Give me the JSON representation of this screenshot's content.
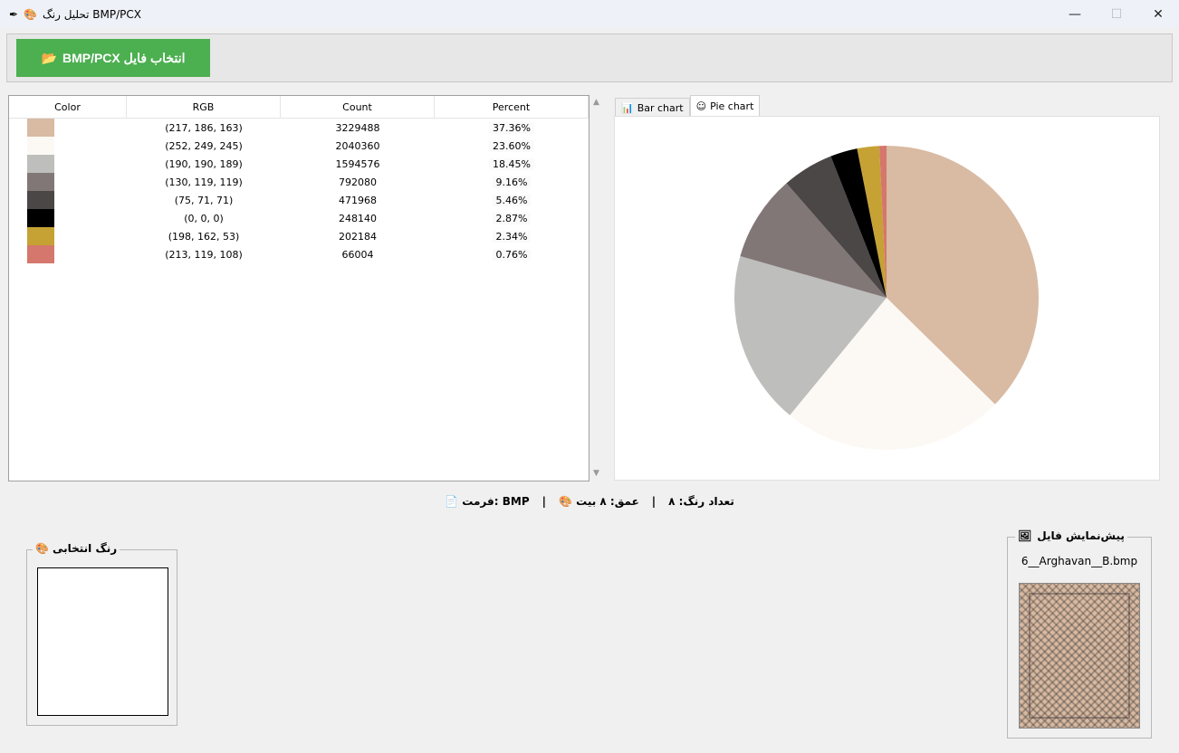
{
  "window": {
    "title": "تحلیل رنگ BMP/PCX",
    "controls": {
      "minimize": "—",
      "maximize": "☐",
      "close": "✕"
    }
  },
  "toolbar": {
    "pick_label": "انتخاب فایل BMP/PCX",
    "pick_icon": "📂",
    "button_color": "#4caf50"
  },
  "table": {
    "columns": [
      "Color",
      "RGB",
      "Count",
      "Percent"
    ],
    "rows": [
      {
        "color": "#d9baa3",
        "rgb": "(217, 186, 163)",
        "count": "3229488",
        "percent": "37.36%"
      },
      {
        "color": "#fcf9f5",
        "rgb": "(252, 249, 245)",
        "count": "2040360",
        "percent": "23.60%"
      },
      {
        "color": "#bebebd",
        "rgb": "(190, 190, 189)",
        "count": "1594576",
        "percent": "18.45%"
      },
      {
        "color": "#827777",
        "rgb": "(130, 119, 119)",
        "count": "792080",
        "percent": "9.16%"
      },
      {
        "color": "#4b4747",
        "rgb": "(75, 71, 71)",
        "count": "471968",
        "percent": "5.46%"
      },
      {
        "color": "#000000",
        "rgb": "(0, 0, 0)",
        "count": "248140",
        "percent": "2.87%"
      },
      {
        "color": "#c6a235",
        "rgb": "(198, 162, 53)",
        "count": "202184",
        "percent": "2.34%"
      },
      {
        "color": "#d5776c",
        "rgb": "(213, 119, 108)",
        "count": "66004",
        "percent": "0.76%"
      }
    ]
  },
  "tabs": [
    {
      "label": "Bar chart",
      "icon": "📊"
    },
    {
      "label": "Pie chart",
      "icon": "☺"
    }
  ],
  "chart_data": {
    "type": "pie",
    "values": [
      37.36,
      23.6,
      18.45,
      9.16,
      5.46,
      2.87,
      2.34,
      0.76
    ],
    "colors": [
      "#d9baa3",
      "#fcf9f5",
      "#bebebd",
      "#827777",
      "#4b4747",
      "#000000",
      "#c6a235",
      "#d5776c"
    ],
    "start": "top",
    "direction": "clockwise"
  },
  "status": {
    "colors": "تعداد رنگ: ۸",
    "sep1": "|",
    "depth": "عمق: ۸ بیت 🎨",
    "sep2": "|",
    "format": "📄 فرمت: BMP"
  },
  "selected_group": {
    "label": "رنگ انتخابی",
    "icon": "🎨",
    "color": "#ffffff"
  },
  "preview_group": {
    "label": "پیش‌نمایش فایل",
    "icon": "🖼",
    "filename": "6__Arghavan__B.bmp"
  }
}
